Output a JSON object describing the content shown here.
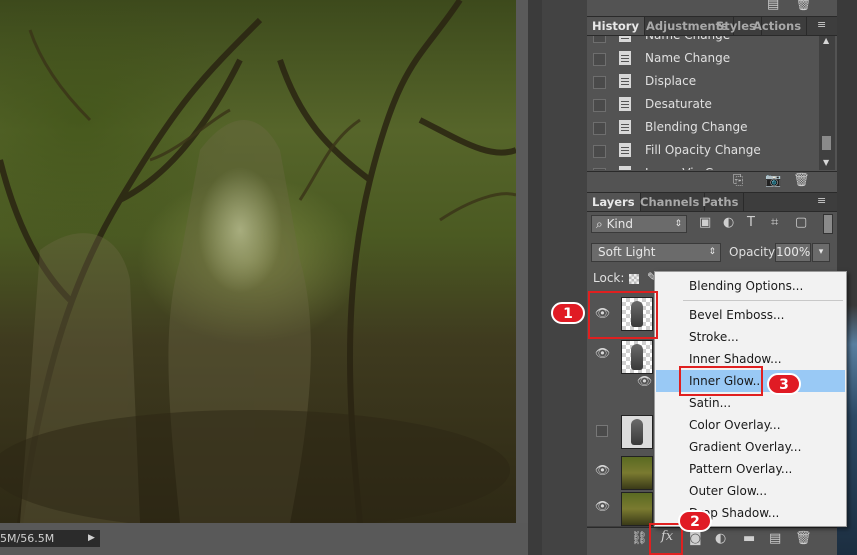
{
  "status_bar": {
    "doc_size": "5M/56.5M"
  },
  "history_panel": {
    "tabs": [
      "History",
      "Adjustments",
      "Styles",
      "Actions"
    ],
    "items": [
      "Name Change",
      "Name Change",
      "Displace",
      "Desaturate",
      "Blending Change",
      "Fill Opacity Change",
      "Layer Via Copy"
    ]
  },
  "layers_panel": {
    "tabs": [
      "Layers",
      "Channels",
      "Paths"
    ],
    "filter_kind": "Kind",
    "blend_mode": "Soft Light",
    "opacity_label": "Opacity:",
    "opacity_value": "100%",
    "lock_label": "Lock:"
  },
  "context_menu": {
    "items": [
      "Blending Options...",
      "Bevel  Emboss...",
      "Stroke...",
      "Inner Shadow...",
      "Inner Glow...",
      "Satin...",
      "Color Overlay...",
      "Gradient Overlay...",
      "Pattern Overlay...",
      "Outer Glow...",
      "Drop Shadow..."
    ],
    "highlighted": "Inner Glow..."
  },
  "annotations": [
    "1",
    "2",
    "3"
  ],
  "fx_label": "fx",
  "colors": {
    "annotation_red": "#e01b24",
    "menu_highlight": "#99c9f5",
    "panel_bg": "#535353"
  }
}
